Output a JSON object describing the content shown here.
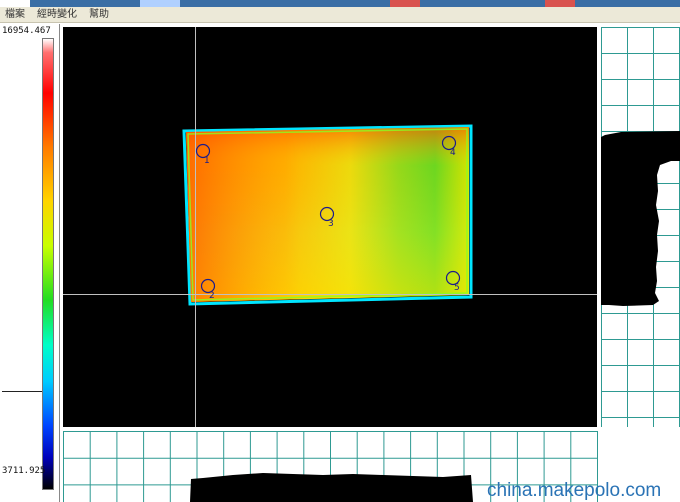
{
  "menu": {
    "items": [
      {
        "label": "檔案"
      },
      {
        "label": "經時變化"
      },
      {
        "label": "幫助"
      }
    ]
  },
  "scale": {
    "max_label": "16954.467",
    "min_label": "3711.925",
    "pointer_level": 0.78
  },
  "measurement_points": [
    {
      "label": "1"
    },
    {
      "label": "2"
    },
    {
      "label": "3"
    },
    {
      "label": "4"
    },
    {
      "label": "5"
    }
  ],
  "colors": {
    "background": "#000000",
    "profile_grid": "#2e9a92",
    "crosshair": "#c0c0c0",
    "marker": "#1b1b8c",
    "menu_bar": "#ece9d8",
    "watermark": "#2a73b5"
  },
  "watermark": {
    "text": "china.makepolo.com"
  }
}
